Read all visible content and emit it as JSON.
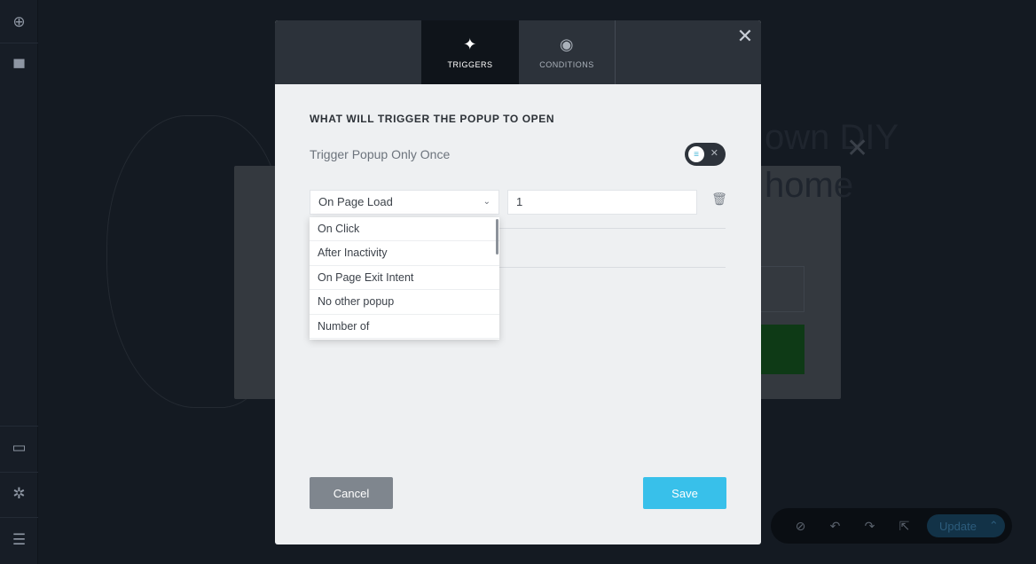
{
  "rail": {
    "icons": [
      "plus-circle-icon",
      "widgets-icon",
      "desktop-icon",
      "gear-icon",
      "hamburger-icon"
    ]
  },
  "background": {
    "heading_line1": "own DIY",
    "heading_line2": "home",
    "update_label": "Update"
  },
  "modal": {
    "tabs": [
      {
        "label": "TRIGGERS",
        "icon": "sparkles-icon",
        "active": true
      },
      {
        "label": "CONDITIONS",
        "icon": "eye-icon",
        "active": false
      }
    ],
    "section_title": "WHAT WILL TRIGGER THE POPUP TO OPEN",
    "trigger_once_label": "Trigger Popup Only Once",
    "trigger_once_enabled": true,
    "trigger_select": {
      "value": "On Page Load"
    },
    "trigger_value": "1",
    "dropdown_options": [
      "On Click",
      "After Inactivity",
      "On Page Exit Intent",
      "No other popup",
      "Number of"
    ],
    "cancel_label": "Cancel",
    "save_label": "Save"
  },
  "colors": {
    "accent": "#38c0ea",
    "header": "#2c323a",
    "active_tab": "#0f141a",
    "cancel": "#7f868e"
  }
}
